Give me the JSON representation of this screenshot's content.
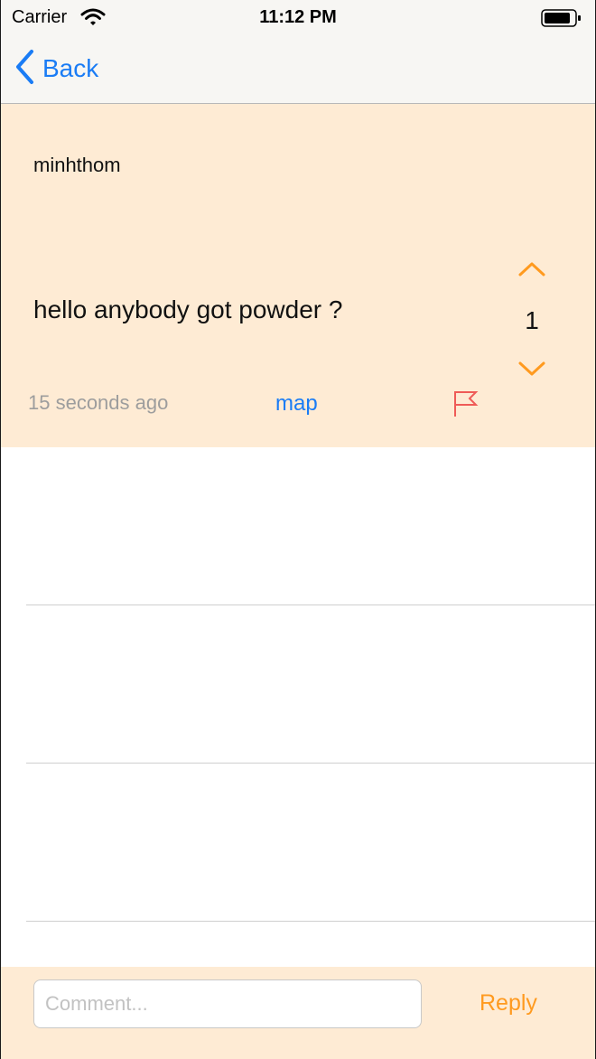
{
  "status_bar": {
    "carrier": "Carrier",
    "time": "11:12 PM",
    "icons": [
      "wifi-icon",
      "battery-icon"
    ]
  },
  "nav": {
    "back_label": "Back",
    "back_icon": "chevron-left-icon"
  },
  "post": {
    "username": "minhthom",
    "message": "hello anybody got powder ?",
    "vote_count": "1",
    "timestamp": "15 seconds ago",
    "map_label": "map",
    "icons": [
      "chevron-up-icon",
      "chevron-down-icon",
      "flag-icon"
    ]
  },
  "comments": [],
  "reply_bar": {
    "comment_placeholder": "Comment...",
    "comment_value": "",
    "reply_label": "Reply"
  },
  "colors": {
    "accent_blue": "#1a7cf5",
    "accent_orange": "#ff9a1f",
    "card_background": "#feebd4",
    "flag_red": "#ef5b57",
    "muted_text": "#9d9d9d"
  }
}
